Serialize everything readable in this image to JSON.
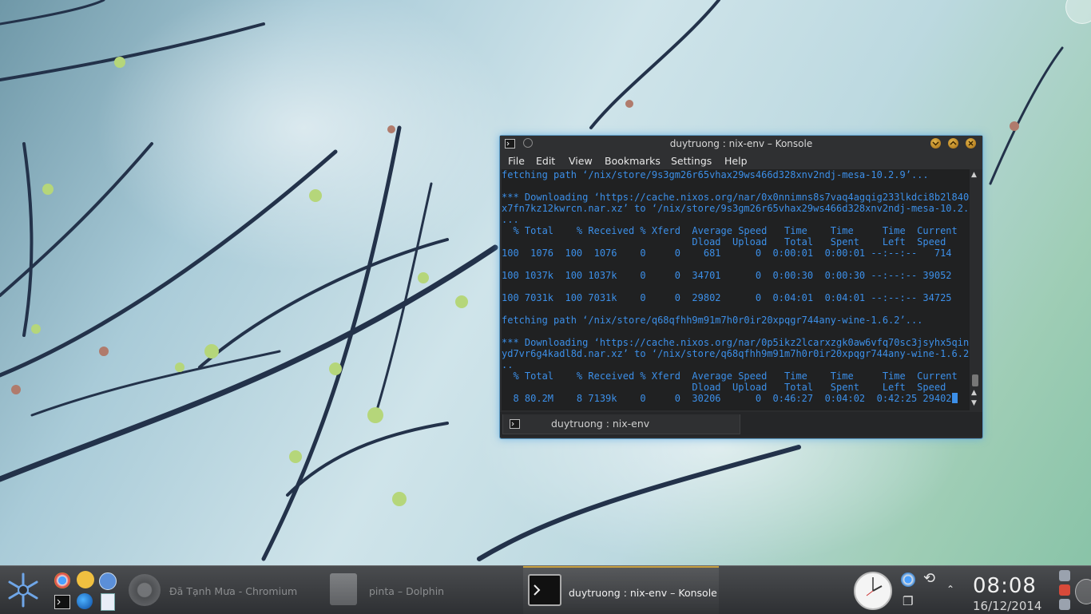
{
  "window": {
    "title": "duytruong : nix-env – Konsole",
    "menu": [
      "File",
      "Edit",
      "View",
      "Bookmarks",
      "Settings",
      "Help"
    ],
    "tab_label": "duytruong : nix-env"
  },
  "terminal": {
    "lines": [
      "fetching path ‘/nix/store/9s3gm26r65vhax29ws466d328xnv2ndj-mesa-10.2.9’...",
      "",
      "*** Downloading ‘https://cache.nixos.org/nar/0x0nnimns8s7vaq4agqig233lkdci8b2l840jd",
      "x7fn7kz12kwrcn.nar.xz’ to ‘/nix/store/9s3gm26r65vhax29ws466d328xnv2ndj-mesa-10.2.9’",
      "...",
      "  % Total    % Received % Xferd  Average Speed   Time    Time     Time  Current",
      "                                 Dload  Upload   Total   Spent    Left  Speed",
      "100  1076  100  1076    0     0    681      0  0:00:01  0:00:01 --:--:--   714",
      "",
      "100 1037k  100 1037k    0     0  34701      0  0:00:30  0:00:30 --:--:-- 39052",
      "",
      "100 7031k  100 7031k    0     0  29802      0  0:04:01  0:04:01 --:--:-- 34725",
      "",
      "fetching path ‘/nix/store/q68qfhh9m91m7h0r0ir20xpqgr744any-wine-1.6.2’...",
      "",
      "*** Downloading ‘https://cache.nixos.org/nar/0p5ikz2lcarxzgk0aw6vfq70sc3jsyhx5qinp1",
      "yd7vr6g4kadl8d.nar.xz’ to ‘/nix/store/q68qfhh9m91m7h0r0ir20xpqgr744any-wine-1.6.2’.",
      "..",
      "  % Total    % Received % Xferd  Average Speed   Time    Time     Time  Current",
      "                                 Dload  Upload   Total   Spent    Left  Speed"
    ],
    "last_line": "  8 80.2M    8 7139k    0     0  30206      0  0:46:27  0:04:02  0:42:25 29402"
  },
  "taskbar": {
    "tasks": [
      {
        "label": "Đã Tạnh Mưa - Chromium",
        "icon": "chromium-icon"
      },
      {
        "label": "pinta – Dolphin",
        "icon": "dolphin-icon"
      },
      {
        "label": "duytruong : nix-env – Konsole",
        "icon": "konsole-icon"
      }
    ],
    "clock": {
      "time": "08:08",
      "date": "16/12/2014"
    }
  },
  "colors": {
    "terminal_text": "#3c8fe8",
    "accent": "#5c98c0"
  }
}
